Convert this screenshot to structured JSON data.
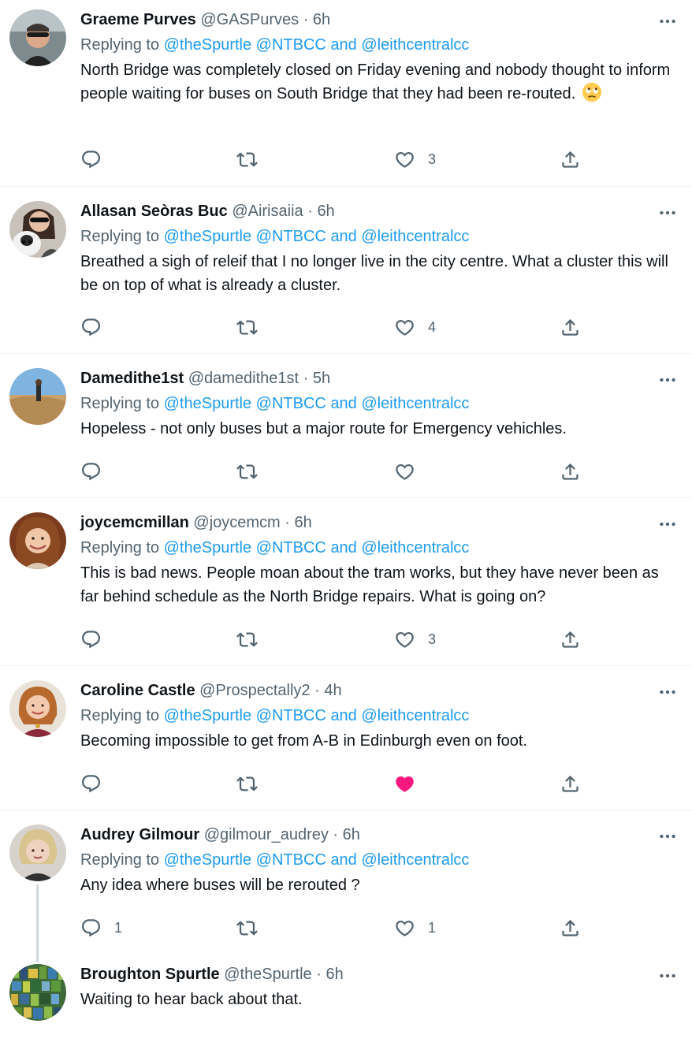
{
  "colors": {
    "link": "#1d9bf0",
    "secondary_text": "#536471",
    "primary_text": "#0f1419",
    "liked_heart": "#f91880",
    "divider": "#eff3f4",
    "thread_line": "#cfd9de"
  },
  "tweets": [
    {
      "name": "Graeme Purves",
      "handle": "@GASPurves",
      "sep": "·",
      "time": "6h",
      "replying_label": "Replying to",
      "mentions": [
        "@theSpurtle",
        "@NTBCC",
        "@leithcentralcc"
      ],
      "and_label": "and",
      "text": "North Bridge was completely closed on Friday evening and nobody thought to inform people waiting for buses on South Bridge that they had been re-routed.",
      "emoji": "face-with-rolling-eyes",
      "reply_count": "",
      "retweet_count": "",
      "like_count": "3",
      "liked": false
    },
    {
      "name": "Allasan Seòras Buc",
      "handle": "@Airisaiia",
      "sep": "·",
      "time": "6h",
      "replying_label": "Replying to",
      "mentions": [
        "@theSpurtle",
        "@NTBCC",
        "@leithcentralcc"
      ],
      "and_label": "and",
      "text": "Breathed a sigh of releif that I no longer live in the city centre. What a cluster this will be on top of what is already a cluster.",
      "reply_count": "",
      "retweet_count": "",
      "like_count": "4",
      "liked": false
    },
    {
      "name": "Damedithe1st",
      "handle": "@damedithe1st",
      "sep": "·",
      "time": "5h",
      "replying_label": "Replying to",
      "mentions": [
        "@theSpurtle",
        "@NTBCC",
        "@leithcentralcc"
      ],
      "and_label": "and",
      "text": "Hopeless - not only buses but a major route for Emergency vehichles.",
      "reply_count": "",
      "retweet_count": "",
      "like_count": "",
      "liked": false
    },
    {
      "name": "joycemcmillan",
      "handle": "@joycemcm",
      "sep": "·",
      "time": "6h",
      "replying_label": "Replying to",
      "mentions": [
        "@theSpurtle",
        "@NTBCC",
        "@leithcentralcc"
      ],
      "and_label": "and",
      "text": "This is bad news. People moan about the tram works, but they have never been as far behind schedule as the North Bridge repairs. What is going on?",
      "reply_count": "",
      "retweet_count": "",
      "like_count": "3",
      "liked": false
    },
    {
      "name": "Caroline Castle",
      "handle": "@Prospectally2",
      "sep": "·",
      "time": "4h",
      "replying_label": "Replying to",
      "mentions": [
        "@theSpurtle",
        "@NTBCC",
        "@leithcentralcc"
      ],
      "and_label": "and",
      "text": "Becoming impossible to get from A-B in Edinburgh even on foot.",
      "reply_count": "",
      "retweet_count": "",
      "like_count": "",
      "liked": true
    },
    {
      "name": "Audrey Gilmour",
      "handle": "@gilmour_audrey",
      "sep": "·",
      "time": "6h",
      "replying_label": "Replying to",
      "mentions": [
        "@theSpurtle",
        "@NTBCC",
        "@leithcentralcc"
      ],
      "and_label": "and",
      "text": "Any idea where buses will be rerouted ?",
      "reply_count": "1",
      "retweet_count": "",
      "like_count": "1",
      "liked": false
    },
    {
      "name": "Broughton Spurtle",
      "handle": "@theSpurtle",
      "sep": "·",
      "time": "6h",
      "text": "Waiting to hear back about that."
    }
  ]
}
